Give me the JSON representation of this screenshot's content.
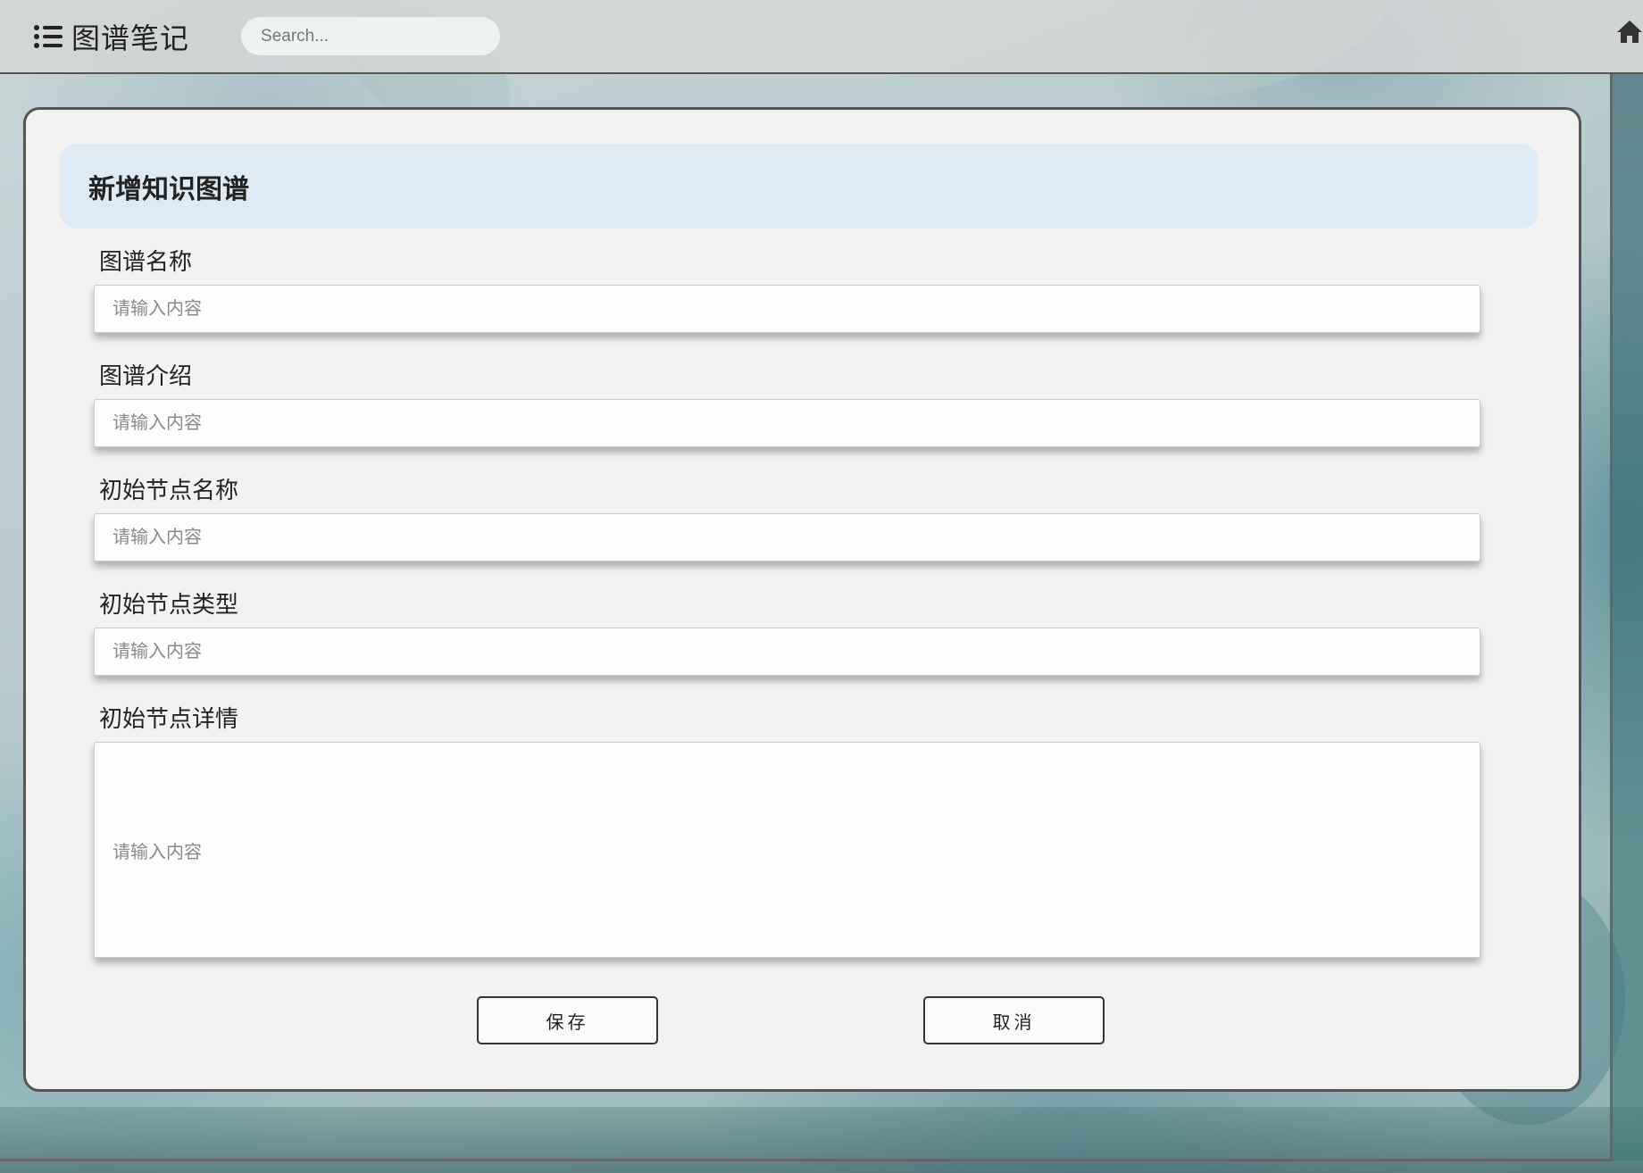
{
  "header": {
    "app_title": "图谱笔记",
    "search_placeholder": "Search...",
    "menu_icon": "list-icon",
    "home_icon": "home-icon"
  },
  "form": {
    "title": "新增知识图谱",
    "fields": [
      {
        "label": "图谱名称",
        "placeholder": "请输入内容",
        "value": ""
      },
      {
        "label": "图谱介绍",
        "placeholder": "请输入内容",
        "value": ""
      },
      {
        "label": "初始节点名称",
        "placeholder": "请输入内容",
        "value": ""
      },
      {
        "label": "初始节点类型",
        "placeholder": "请输入内容",
        "value": ""
      },
      {
        "label": "初始节点详情",
        "placeholder": "请输入内容",
        "value": ""
      }
    ],
    "save_label": "保存",
    "cancel_label": "取消"
  },
  "colors": {
    "header_bg": "#d6d6d6",
    "card_bg": "#f2f2f2",
    "title_banner_bg": "#deebf5",
    "border": "#555555"
  }
}
